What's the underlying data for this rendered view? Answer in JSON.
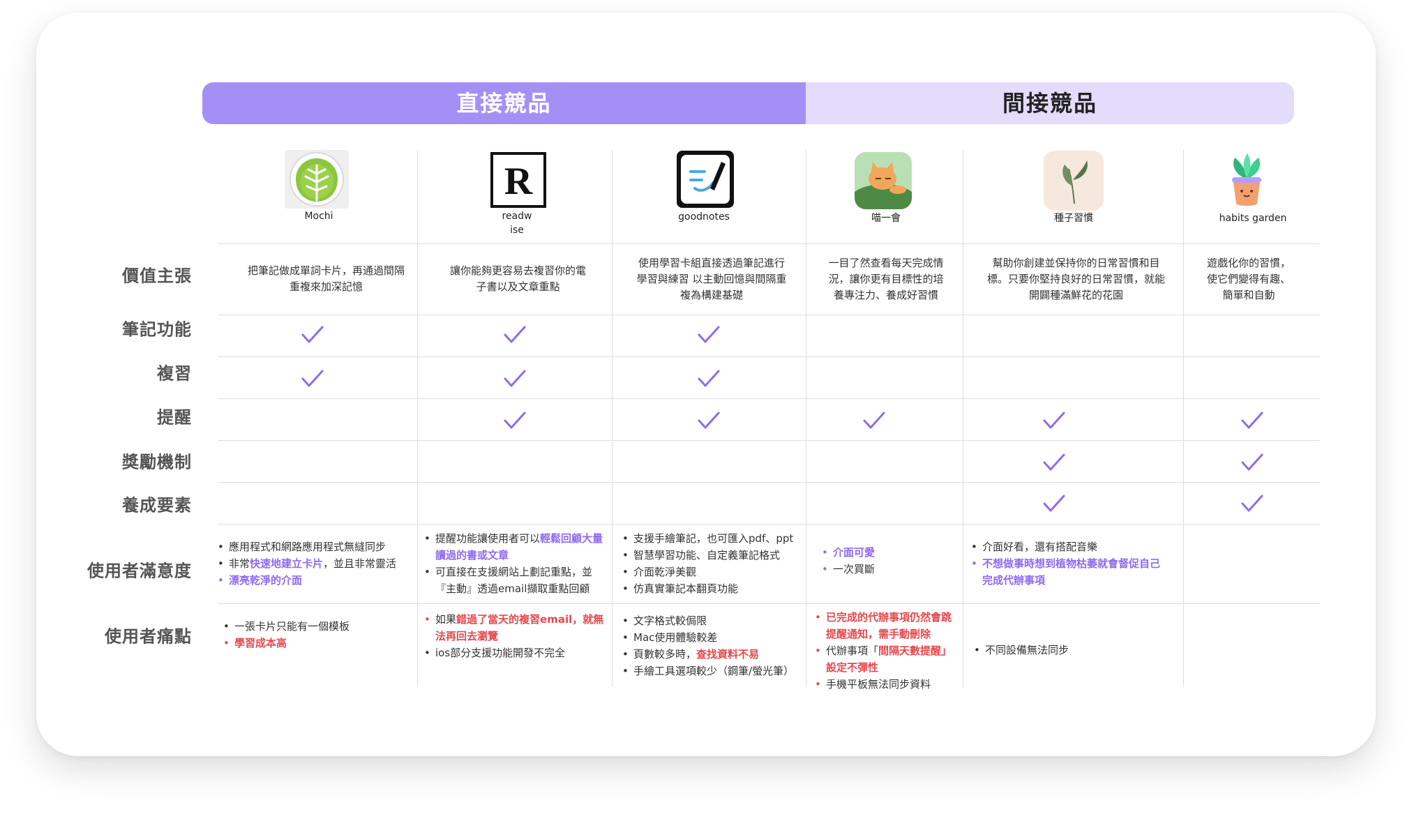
{
  "headers": {
    "direct": "直接競品",
    "indirect": "間接競品"
  },
  "products": [
    {
      "name": "Mochi"
    },
    {
      "name": "readw\nise"
    },
    {
      "name": "goodnotes"
    },
    {
      "name": "喵一會"
    },
    {
      "name": "種子習慣"
    },
    {
      "name": "habits garden"
    }
  ],
  "row_labels": {
    "value": "價值主張",
    "notes": "筆記功能",
    "review": "複習",
    "reminder": "提醒",
    "reward": "獎勵機制",
    "habit": "養成要素",
    "satisfaction": "使用者滿意度",
    "pain": "使用者痛點"
  },
  "value_props": [
    "把筆記做成單詞卡片，再通過間隔重複來加深記憶",
    "讓你能夠更容易去複習你的電子書以及文章重點",
    "使用學習卡組直接透過筆記進行學習與練習 以主動回憶與間隔重複為構建基礎",
    "一目了然查看每天完成情況，讓你更有目標性的培養專注力、養成好習慣",
    "幫助你創建並保持你的日常習慣和目標。只要你堅持良好的日常習慣，就能開闢種滿鮮花的花園",
    "遊戲化你的習慣，使它們變得有趣、簡單和自動"
  ],
  "checks": {
    "notes": [
      true,
      true,
      true,
      false,
      false,
      false
    ],
    "review": [
      true,
      true,
      true,
      false,
      false,
      false
    ],
    "reminder": [
      false,
      true,
      true,
      true,
      true,
      true
    ],
    "reward": [
      false,
      false,
      false,
      false,
      true,
      true
    ],
    "habit": [
      false,
      false,
      false,
      false,
      true,
      true
    ]
  },
  "satisfaction": {
    "mochi": {
      "i1": "應用程式和網路應用程式無縫同步",
      "i2a": "非常",
      "i2b": "快速地建立卡片",
      "i2c": "，並且非常靈活",
      "i3": "漂亮乾淨的介面"
    },
    "readwise": {
      "i1a": "提醒功能讓使用者可以",
      "i1b": "輕鬆回顧大量讀過的書或文章",
      "i2": "可直接在支援網站上劃記重點，並『主動』透過email擷取重點回顧"
    },
    "goodnotes": {
      "i1": "支援手繪筆記，也可匯入pdf、ppt",
      "i2": "智慧學習功能、自定義筆記格式",
      "i3": "介面乾淨美觀",
      "i4": "仿真實筆記本翻頁功能"
    },
    "meow": {
      "i1": "介面可愛",
      "i2": "一次買斷"
    },
    "seed": {
      "i1": "介面好看，還有搭配音樂",
      "i2": "不想做事時想到植物枯萎就會督促自己完成代辦事項"
    }
  },
  "pain": {
    "mochi": {
      "i1": "一張卡片只能有一個模板",
      "i2": "學習成本高"
    },
    "readwise": {
      "i1a": "如果",
      "i1b": "錯過了當天的複習email，就無法再回去瀏覽",
      "i2": "ios部分支援功能開發不完全"
    },
    "goodnotes": {
      "i1": "文字格式較侷限",
      "i2": "Mac使用體驗較差",
      "i3a": "頁數較多時，",
      "i3b": "查找資料不易",
      "i4": "手繪工具選項較少（鋼筆/螢光筆）"
    },
    "meow": {
      "i1": "已完成的代辦事項仍然會跳提醒通知，需手動刪除",
      "i2a": "代辦事項「",
      "i2b": "間隔天數提醒」設定不彈性",
      "i3": "手機平板無法同步資料"
    },
    "seed": {
      "i1": "不同設備無法同步"
    }
  },
  "colors": {
    "accent": "#a490f5",
    "accent_light": "#e3dcfb",
    "check": "#8e6bee",
    "red": "#e5484d"
  }
}
